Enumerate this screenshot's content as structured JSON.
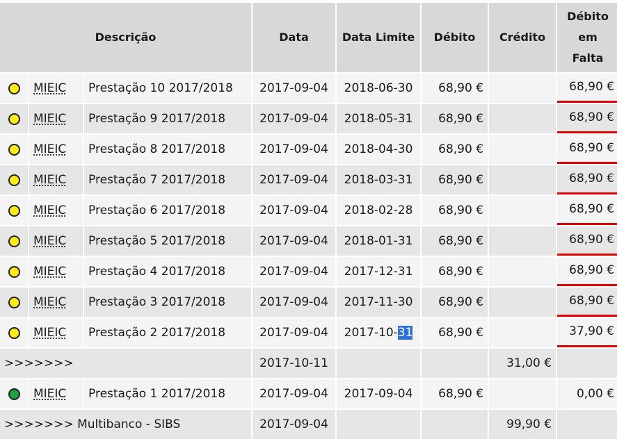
{
  "headers": {
    "descricao": "Descrição",
    "data": "Data",
    "data_limite": "Data Limite",
    "debito": "Débito",
    "credito": "Crédito",
    "debito_falta_1": "Débito",
    "debito_falta_2": "em",
    "debito_falta_3": "Falta"
  },
  "rows": [
    {
      "status": "pending",
      "course": "MIEIC",
      "desc": "Prestação 10 2017/2018",
      "data": "2017-09-04",
      "limite": "2018-06-30",
      "debito": "68,90 €",
      "credito": "",
      "falta": "68,90 €"
    },
    {
      "status": "pending",
      "course": "MIEIC",
      "desc": "Prestação 9 2017/2018",
      "data": "2017-09-04",
      "limite": "2018-05-31",
      "debito": "68,90 €",
      "credito": "",
      "falta": "68,90 €"
    },
    {
      "status": "pending",
      "course": "MIEIC",
      "desc": "Prestação 8 2017/2018",
      "data": "2017-09-04",
      "limite": "2018-04-30",
      "debito": "68,90 €",
      "credito": "",
      "falta": "68,90 €"
    },
    {
      "status": "pending",
      "course": "MIEIC",
      "desc": "Prestação 7 2017/2018",
      "data": "2017-09-04",
      "limite": "2018-03-31",
      "debito": "68,90 €",
      "credito": "",
      "falta": "68,90 €"
    },
    {
      "status": "pending",
      "course": "MIEIC",
      "desc": "Prestação 6 2017/2018",
      "data": "2017-09-04",
      "limite": "2018-02-28",
      "debito": "68,90 €",
      "credito": "",
      "falta": "68,90 €"
    },
    {
      "status": "pending",
      "course": "MIEIC",
      "desc": "Prestação 5 2017/2018",
      "data": "2017-09-04",
      "limite": "2018-01-31",
      "debito": "68,90 €",
      "credito": "",
      "falta": "68,90 €"
    },
    {
      "status": "pending",
      "course": "MIEIC",
      "desc": "Prestação 4 2017/2018",
      "data": "2017-09-04",
      "limite": "2017-12-31",
      "debito": "68,90 €",
      "credito": "",
      "falta": "68,90 €"
    },
    {
      "status": "pending",
      "course": "MIEIC",
      "desc": "Prestação 3 2017/2018",
      "data": "2017-09-04",
      "limite": "2017-11-30",
      "debito": "68,90 €",
      "credito": "",
      "falta": "68,90 €"
    },
    {
      "status": "pending",
      "course": "MIEIC",
      "desc": "Prestação 2 2017/2018",
      "data": "2017-09-04",
      "limite_prefix": "2017-10-",
      "limite_selected": "31",
      "debito": "68,90 €",
      "credito": "",
      "falta": "37,90 €"
    }
  ],
  "payment_row_1": {
    "desc": ">>>>>>>",
    "data": "2017-10-11",
    "credito": "31,00 €"
  },
  "paid_row": {
    "status": "paid",
    "course": "MIEIC",
    "desc": "Prestação 1 2017/2018",
    "data": "2017-09-04",
    "limite": "2017-09-04",
    "debito": "68,90 €",
    "credito": "",
    "falta": "0,00 €"
  },
  "payment_row_2": {
    "desc": ">>>>>>> Multibanco - SIBS",
    "data": "2017-09-04",
    "credito": "99,90 €"
  },
  "colors": {
    "pending": "#ffeb1a",
    "paid": "#20a040",
    "debt_underline": "#e00000",
    "selection": "#2f6fd6"
  }
}
